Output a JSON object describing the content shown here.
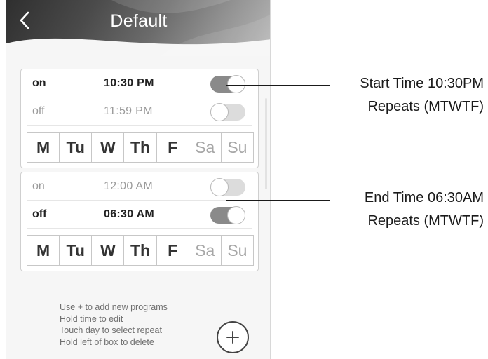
{
  "header": {
    "title": "Default",
    "back_icon": "chevron-left-icon"
  },
  "programs": [
    {
      "rows": [
        {
          "state": "on",
          "time": "10:30 PM",
          "toggle": true,
          "active": true
        },
        {
          "state": "off",
          "time": "11:59 PM",
          "toggle": false,
          "active": false
        }
      ],
      "days": [
        {
          "label": "M",
          "selected": true
        },
        {
          "label": "Tu",
          "selected": true
        },
        {
          "label": "W",
          "selected": true
        },
        {
          "label": "Th",
          "selected": true
        },
        {
          "label": "F",
          "selected": true
        },
        {
          "label": "Sa",
          "selected": false
        },
        {
          "label": "Su",
          "selected": false
        }
      ]
    },
    {
      "rows": [
        {
          "state": "on",
          "time": "12:00 AM",
          "toggle": false,
          "active": false
        },
        {
          "state": "off",
          "time": "06:30 AM",
          "toggle": true,
          "active": true
        }
      ],
      "days": [
        {
          "label": "M",
          "selected": true
        },
        {
          "label": "Tu",
          "selected": true
        },
        {
          "label": "W",
          "selected": true
        },
        {
          "label": "Th",
          "selected": true
        },
        {
          "label": "F",
          "selected": true
        },
        {
          "label": "Sa",
          "selected": false
        },
        {
          "label": "Su",
          "selected": false
        }
      ]
    }
  ],
  "instructions": [
    "Use + to add new programs",
    "Hold time to edit",
    "Touch day to select repeat",
    "Hold left of box to delete"
  ],
  "add_button": {
    "icon": "plus-circle-icon"
  },
  "callouts": [
    {
      "line1": "Start Time 10:30PM",
      "line2": "Repeats (MTWTF)"
    },
    {
      "line1": "End Time 06:30AM",
      "line2": "Repeats (MTWTF)"
    }
  ],
  "colors": {
    "toggle_on": "#8a8a8a",
    "toggle_off": "#dcdcdc",
    "text_active": "#222222",
    "text_inactive": "#9a9a9a"
  }
}
